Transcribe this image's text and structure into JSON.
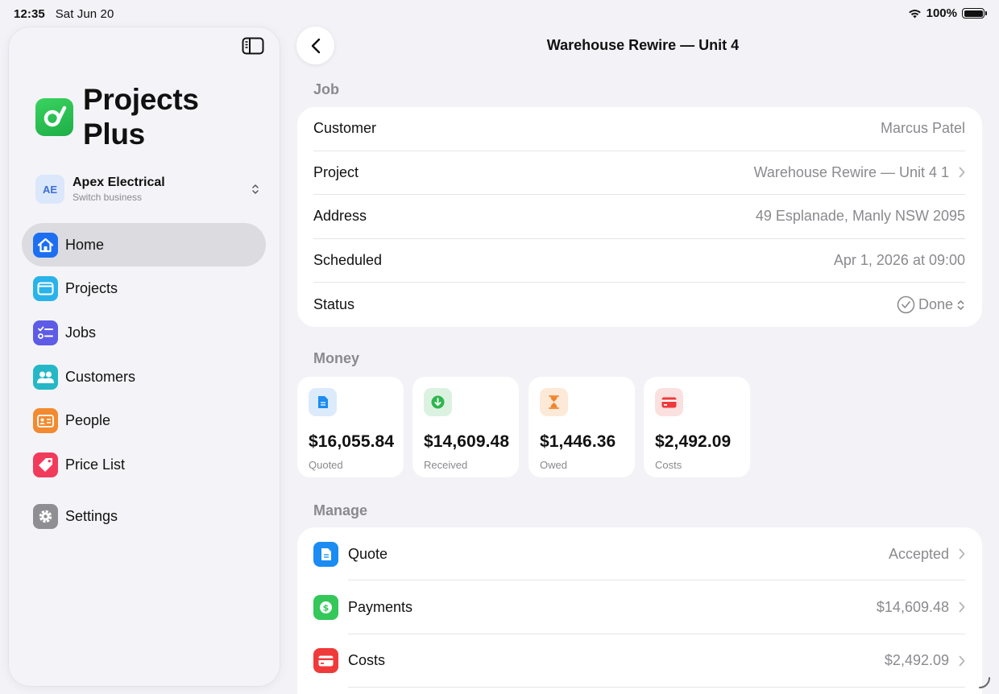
{
  "status_bar": {
    "time": "12:35",
    "date": "Sat Jun 20",
    "battery": "100%"
  },
  "sidebar": {
    "app_name": "Projects Plus",
    "business": {
      "initials": "AE",
      "name": "Apex Electrical",
      "subtitle": "Switch business"
    },
    "items": [
      {
        "label": "Home",
        "icon": "house-icon",
        "color": "#1d6ff2",
        "active": true
      },
      {
        "label": "Projects",
        "icon": "folder-icon",
        "color": "#2ab3ea"
      },
      {
        "label": "Jobs",
        "icon": "checklist-icon",
        "color": "#5e5ce6"
      },
      {
        "label": "Customers",
        "icon": "people-icon",
        "color": "#25b7c6"
      },
      {
        "label": "People",
        "icon": "id-card-icon",
        "color": "#f28a2f"
      },
      {
        "label": "Price List",
        "icon": "tag-icon",
        "color": "#f23b5c"
      },
      {
        "label": "Settings",
        "icon": "gear-icon",
        "color": "#8e8e93"
      }
    ]
  },
  "header": {
    "title": "Warehouse Rewire — Unit 4"
  },
  "job": {
    "section_label": "Job",
    "rows": [
      {
        "label": "Customer",
        "value": "Marcus Patel"
      },
      {
        "label": "Project",
        "value": "Warehouse Rewire — Unit 4 1"
      },
      {
        "label": "Address",
        "value": "49 Esplanade, Manly NSW 2095"
      },
      {
        "label": "Scheduled",
        "value": "Apr 1, 2026 at 09:00"
      },
      {
        "label": "Status",
        "value": "Done"
      }
    ]
  },
  "money": {
    "section_label": "Money",
    "cards": [
      {
        "value": "$16,055.84",
        "label": "Quoted",
        "icon": "document-icon",
        "color": "#1a8cf2",
        "bg": "#dcebfb"
      },
      {
        "value": "$14,609.48",
        "label": "Received",
        "icon": "arrow-down-circle-icon",
        "color": "#2fb54f",
        "bg": "#dcf2e1"
      },
      {
        "value": "$1,446.36",
        "label": "Owed",
        "icon": "hourglass-icon",
        "color": "#f0852d",
        "bg": "#fde9d8"
      },
      {
        "value": "$2,492.09",
        "label": "Costs",
        "icon": "credit-card-icon",
        "color": "#f03a3a",
        "bg": "#fbe0e0"
      }
    ]
  },
  "manage": {
    "section_label": "Manage",
    "rows": [
      {
        "label": "Quote",
        "value": "Accepted",
        "icon": "document-icon",
        "color": "#1a8cf2"
      },
      {
        "label": "Payments",
        "value": "$14,609.48",
        "icon": "dollar-circle-icon",
        "color": "#34c759"
      },
      {
        "label": "Costs",
        "value": "$2,492.09",
        "icon": "credit-card-icon",
        "color": "#f03a3a"
      }
    ]
  }
}
